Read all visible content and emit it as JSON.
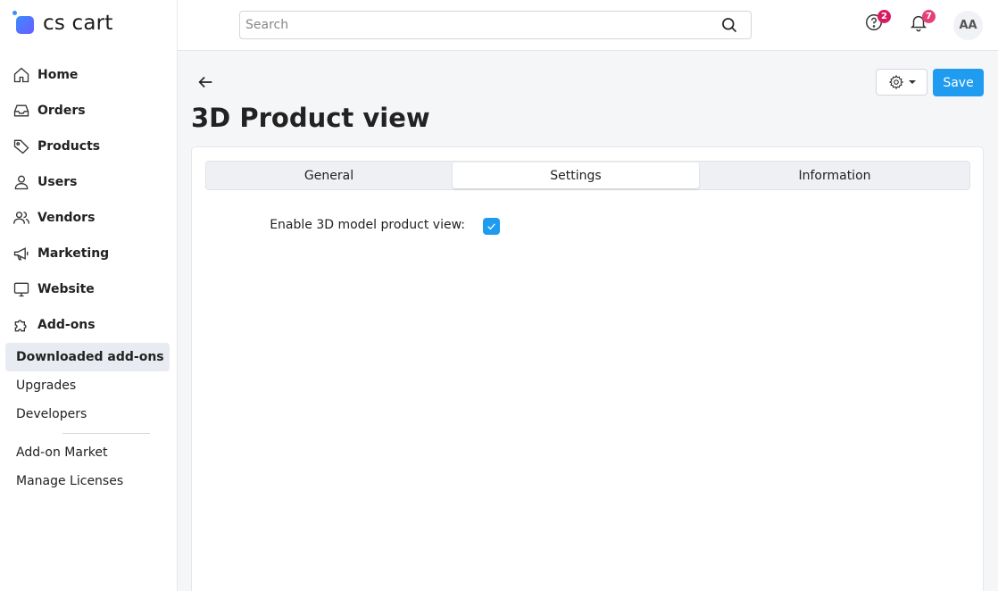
{
  "app": {
    "logo_text": "cs cart"
  },
  "sidebar": {
    "items": [
      {
        "label": "Home",
        "icon": "home-icon"
      },
      {
        "label": "Orders",
        "icon": "inbox-icon"
      },
      {
        "label": "Products",
        "icon": "tag-icon"
      },
      {
        "label": "Users",
        "icon": "user-icon"
      },
      {
        "label": "Vendors",
        "icon": "users-icon"
      },
      {
        "label": "Marketing",
        "icon": "megaphone-icon"
      },
      {
        "label": "Website",
        "icon": "monitor-icon"
      },
      {
        "label": "Add-ons",
        "icon": "puzzle-icon"
      }
    ],
    "subitems": [
      {
        "label": "Downloaded add-ons",
        "active": true
      },
      {
        "label": "Upgrades",
        "active": false
      },
      {
        "label": "Developers",
        "active": false
      },
      {
        "label": "Add-on Market",
        "active": false
      },
      {
        "label": "Manage Licenses",
        "active": false
      }
    ]
  },
  "topbar": {
    "search_placeholder": "Search",
    "help_badge": "2",
    "notifications_badge": "7",
    "avatar_initials": "AA"
  },
  "page": {
    "title": "3D Product view",
    "save_label": "Save",
    "tabs": [
      {
        "label": "General",
        "active": false
      },
      {
        "label": "Settings",
        "active": true
      },
      {
        "label": "Information",
        "active": false
      }
    ],
    "settings": {
      "enable_label": "Enable 3D model product view:",
      "enable_checked": true
    }
  },
  "colors": {
    "accent": "#1f9bf0",
    "help_badge": "#d81b60",
    "notifications_badge": "#e5407a",
    "active_nav_bg": "#e8ecf2"
  }
}
